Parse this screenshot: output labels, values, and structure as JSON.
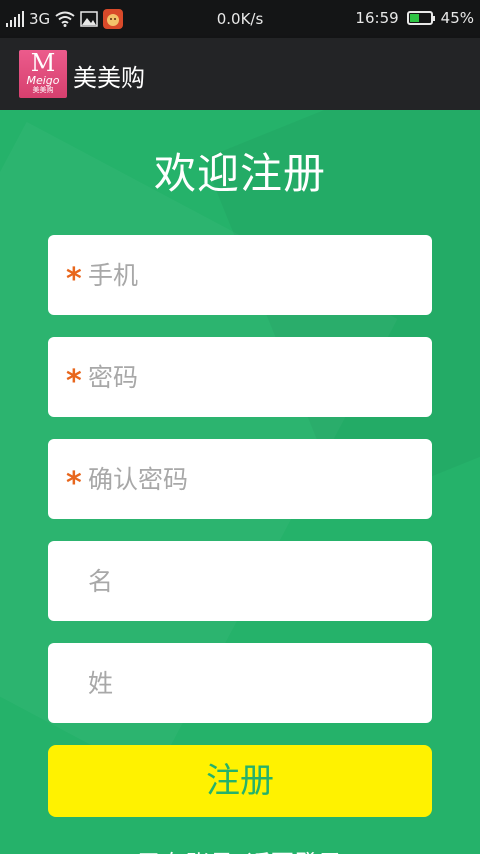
{
  "status_bar": {
    "network": "3G",
    "speed": "0.0K/s",
    "time": "16:59",
    "battery_percent_text": "45%",
    "battery_level": 0.45,
    "battery_color": "#2fc445"
  },
  "app_bar": {
    "logo_letter": "M",
    "logo_word": "Meigo",
    "logo_cn": "美美购",
    "title": "美美购"
  },
  "form": {
    "heading": "欢迎注册",
    "required_mark": "*",
    "phone_placeholder": "手机",
    "password_placeholder": "密码",
    "confirm_placeholder": "确认密码",
    "first_name_placeholder": "名",
    "last_name_placeholder": "姓",
    "submit_label": "注册",
    "bottom_link": "已有账号?返回登录"
  },
  "colors": {
    "background": "#25b26a",
    "button": "#fff200",
    "required": "#e8661c",
    "logo": "#e24f7e"
  }
}
